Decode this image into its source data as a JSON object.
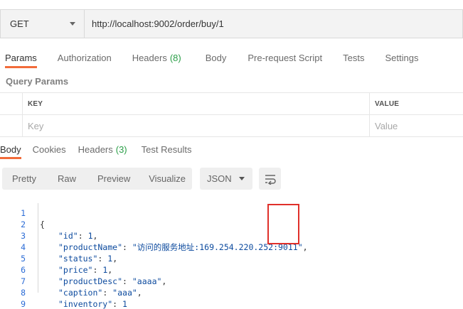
{
  "request": {
    "method": "GET",
    "url": "http://localhost:9002/order/buy/1"
  },
  "request_tabs": [
    {
      "label": "Params",
      "active": true
    },
    {
      "label": "Authorization"
    },
    {
      "label": "Headers",
      "count": "(8)"
    },
    {
      "label": "Body"
    },
    {
      "label": "Pre-request Script"
    },
    {
      "label": "Tests"
    },
    {
      "label": "Settings"
    }
  ],
  "query_params": {
    "title": "Query Params",
    "key_header": "KEY",
    "value_header": "VALUE",
    "key_placeholder": "Key",
    "value_placeholder": "Value"
  },
  "response_tabs": [
    {
      "label": "Body",
      "active": true
    },
    {
      "label": "Cookies"
    },
    {
      "label": "Headers",
      "count": "(3)"
    },
    {
      "label": "Test Results"
    }
  ],
  "view_modes": [
    "Pretty",
    "Raw",
    "Preview",
    "Visualize"
  ],
  "format": "JSON",
  "response_body": {
    "line_numbers": [
      "1",
      "2",
      "3",
      "4",
      "5",
      "6",
      "7",
      "8",
      "9"
    ],
    "open_brace": "{",
    "close_brace": "}",
    "fields": [
      {
        "key": "\"id\"",
        "value": "1",
        "type": "number"
      },
      {
        "key": "\"productName\"",
        "value": "\"访问的服务地址:169.254.220.252:9011\"",
        "type": "string"
      },
      {
        "key": "\"status\"",
        "value": "1",
        "type": "number"
      },
      {
        "key": "\"price\"",
        "value": "1",
        "type": "number"
      },
      {
        "key": "\"productDesc\"",
        "value": "\"aaaa\"",
        "type": "string"
      },
      {
        "key": "\"caption\"",
        "value": "\"aaa\"",
        "type": "string"
      },
      {
        "key": "\"inventory\"",
        "value": "1",
        "type": "number"
      }
    ]
  },
  "colors": {
    "accent": "#f26b3a",
    "count": "#2a9e47",
    "json_text": "#0c4a9e",
    "line_number": "#2b6cd6",
    "highlight": "#e0302a"
  },
  "icons": {
    "method_dropdown": "chevron-down-icon",
    "format_dropdown": "chevron-down-icon",
    "wrap": "wrap-lines-icon"
  }
}
